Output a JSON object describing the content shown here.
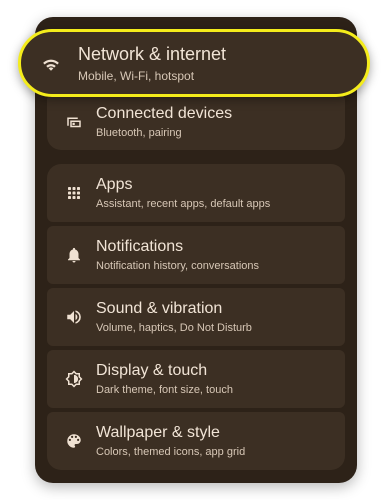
{
  "settings": {
    "highlighted": {
      "title": "Network & internet",
      "subtitle": "Mobile, Wi-Fi, hotspot",
      "icon": "wifi-icon"
    },
    "items": [
      {
        "title": "Connected devices",
        "subtitle": "Bluetooth, pairing",
        "icon": "devices-icon"
      },
      {
        "title": "Apps",
        "subtitle": "Assistant, recent apps, default apps",
        "icon": "apps-grid-icon"
      },
      {
        "title": "Notifications",
        "subtitle": "Notification history, conversations",
        "icon": "bell-icon"
      },
      {
        "title": "Sound & vibration",
        "subtitle": "Volume, haptics, Do Not Disturb",
        "icon": "speaker-icon"
      },
      {
        "title": "Display & touch",
        "subtitle": "Dark theme, font size, touch",
        "icon": "brightness-icon"
      },
      {
        "title": "Wallpaper & style",
        "subtitle": "Colors, themed icons, app grid",
        "icon": "palette-icon"
      }
    ]
  },
  "colors": {
    "panel": "#2d2218",
    "card": "#3c2f23",
    "highlight_border": "#f4ec1b",
    "title_text": "#f1e4d6",
    "subtitle_text": "#d7c7b6"
  }
}
